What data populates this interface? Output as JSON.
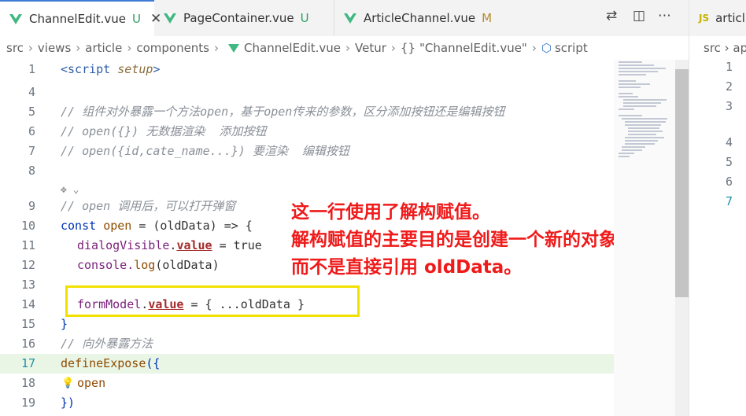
{
  "tabs": [
    {
      "label": "ChannelEdit.vue",
      "status": "U",
      "active": true
    },
    {
      "label": "PageContainer.vue",
      "status": "U"
    },
    {
      "label": "ArticleChannel.vue",
      "status": "M"
    }
  ],
  "tab_close": "✕",
  "actions": {
    "compare": "⇄",
    "split": "◫",
    "more": "⋯"
  },
  "breadcrumb": {
    "parts": [
      "src",
      "views",
      "article",
      "components"
    ],
    "file": "ChannelEdit.vue",
    "lang": "Vetur",
    "braces": "{}",
    "symbol": "\"ChannelEdit.vue\"",
    "section": "script"
  },
  "lines": {
    "l1": {
      "num": "1",
      "open": "<script",
      "attr": "setup",
      "close": ">"
    },
    "l4": {
      "num": "4"
    },
    "l5": {
      "num": "5",
      "text": "// 组件对外暴露一个方法open，基于open传来的参数，区分添加按钮还是编辑按钮"
    },
    "l6": {
      "num": "6",
      "text": "// open({}) 无数据渲染  添加按钮"
    },
    "l7": {
      "num": "7",
      "text": "// open({id,cate_name...}) 要渲染  编辑按钮"
    },
    "l8": {
      "num": "8"
    },
    "l9": {
      "num": "9",
      "text": "// open 调用后，可以打开弹窗"
    },
    "l10": {
      "num": "10",
      "kw": "const",
      "fn": "open",
      "rest": " = (oldData) => {"
    },
    "l11": {
      "num": "11",
      "var": "dialogVisible",
      "dot": ".",
      "prop": "value",
      "rest": " = true"
    },
    "l12": {
      "num": "12",
      "obj": "console.",
      "fn": "log",
      "rest": "(oldData)"
    },
    "l13": {
      "num": "13"
    },
    "l14": {
      "num": "14",
      "var": "formModel",
      "dot": ".",
      "prop": "value",
      "rest": " = { ...oldData }"
    },
    "l15": {
      "num": "15",
      "text": "}"
    },
    "l16": {
      "num": "16",
      "text": "// 向外暴露方法"
    },
    "l17": {
      "num": "17",
      "fn": "defineExpose",
      "rest": "({"
    },
    "l18": {
      "num": "18",
      "bulb": "💡",
      "text": "open"
    },
    "l19": {
      "num": "19",
      "text": "})"
    }
  },
  "annotation": [
    "这一行使用了解构赋值。",
    "解构赋值的主要目的是创建一个新的对象，",
    "而不是直接引用 oldData。"
  ],
  "right_panel": {
    "tab_label": "articl",
    "tab_badge": "JS",
    "breadcrumb": "src › ap",
    "line_numbers": [
      "1",
      "2",
      "3",
      "4",
      "5",
      "6",
      "7"
    ]
  },
  "colors": {
    "annotation": "#ef1a1a",
    "highlight_box": "#f2e000",
    "vue_icon": "#41b883"
  }
}
